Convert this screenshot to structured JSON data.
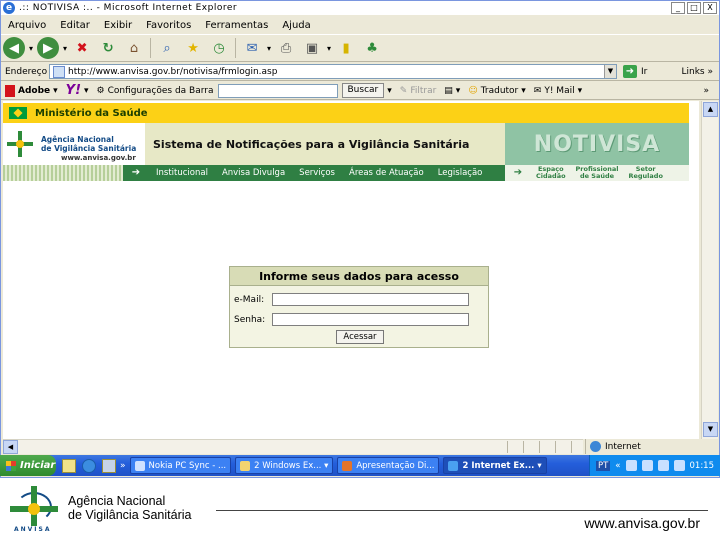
{
  "window": {
    "title": ".:: NOTIVISA :.. - Microsoft Internet Explorer",
    "min_label": "_",
    "max_label": "□",
    "close_label": "X"
  },
  "menu": [
    "Arquivo",
    "Editar",
    "Exibir",
    "Favoritos",
    "Ferramentas",
    "Ajuda"
  ],
  "address": {
    "label": "Endereço",
    "url": "http://www.anvisa.gov.br/notivisa/frmlogin.asp",
    "go_label": "Ir",
    "links_label": "Links",
    "more": "»"
  },
  "linksbar": {
    "adobe": "Adobe",
    "yahoo": "Y!",
    "config": "Configurações da Barra",
    "search_btn": "Buscar",
    "filter": "Filtrar",
    "translator": "Tradutor",
    "mail": "Y! Mail",
    "more": "»"
  },
  "gov": {
    "title": "Ministério da Saúde"
  },
  "header": {
    "agency_line1": "Agência Nacional",
    "agency_line2": "de Vigilância Sanitária",
    "agency_url": "www.anvisa.gov.br",
    "system_title": "Sistema de Notificações para a Vigilância Sanitária",
    "notivisa": "NOTIVISA"
  },
  "nav": {
    "items": [
      "Institucional",
      "Anvisa Divulga",
      "Serviços",
      "Áreas de Atuação",
      "Legislação"
    ],
    "right": [
      {
        "l1": "Espaço",
        "l2": "Cidadão"
      },
      {
        "l1": "Profissional",
        "l2": "de Saúde"
      },
      {
        "l1": "Setor",
        "l2": "Regulado"
      }
    ]
  },
  "login": {
    "heading": "Informe seus dados para acesso",
    "email_label": "e-Mail:",
    "password_label": "Senha:",
    "submit_label": "Acessar"
  },
  "status": {
    "zone": "Internet"
  },
  "taskbar": {
    "start": "Iniciar",
    "more": "»",
    "tasks": [
      {
        "label": "Nokia PC Sync - ...",
        "active": false
      },
      {
        "label": "2 Windows Ex... ▾",
        "active": false
      },
      {
        "label": "Apresentação Di...",
        "active": false
      },
      {
        "label": "2 Internet Ex... ▾",
        "active": true
      }
    ],
    "lang": "PT",
    "clock": "01:15"
  },
  "footer": {
    "logo_tag": "ANVISA",
    "name_line1": "Agência Nacional",
    "name_line2": "de Vigilância Sanitária",
    "url": "www.anvisa.gov.br"
  },
  "colors": {
    "gov_yellow": "#fcd116",
    "nav_green": "#2f7f43",
    "login_header": "#d8dcb6"
  }
}
